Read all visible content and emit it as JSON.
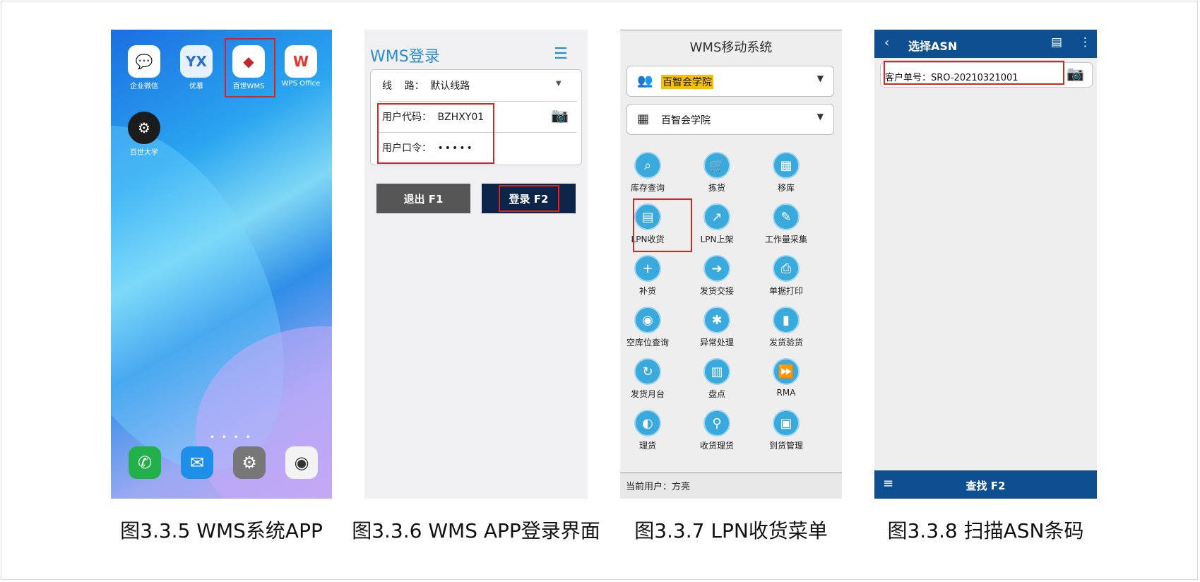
{
  "home": {
    "apps": [
      {
        "name": "企业微信",
        "icon": "wecom-icon"
      },
      {
        "name": "优慕",
        "icon": "youmu-icon"
      },
      {
        "name": "百世WMS",
        "icon": "wms-app-icon"
      },
      {
        "name": "WPS Office",
        "icon": "wps-icon"
      },
      {
        "name": "百世大学",
        "icon": "university-icon"
      }
    ],
    "dock": [
      "phone-icon",
      "message-icon",
      "settings-icon",
      "camera-icon"
    ],
    "icon_glyphs": {
      "wps": "W",
      "youmu": "YX"
    }
  },
  "login": {
    "title": "WMS登录",
    "line_label": "线    路：",
    "line_value": "默认线路",
    "user_label": "用户代码：",
    "user_value": "BZHXY01",
    "password_label": "用户口令：",
    "password_value": "•••••",
    "exit_button": "退出 F1",
    "login_button": "登录 F2",
    "colors": {
      "exit": "#565656",
      "login": "#0c2448",
      "accent": "#2a8fd2"
    }
  },
  "menu": {
    "title": "WMS移动系统",
    "org_select": "百智会学院",
    "warehouse_select": "百智会学院",
    "items": [
      {
        "label": "库存查询",
        "icon": "inventory-search-icon",
        "glyph": "⌕"
      },
      {
        "label": "拣货",
        "icon": "cart-icon",
        "glyph": "🛒"
      },
      {
        "label": "移库",
        "icon": "move-stock-icon",
        "glyph": "▦"
      },
      {
        "label": "LPN收货",
        "icon": "lpn-receive-icon",
        "glyph": "▤"
      },
      {
        "label": "LPN上架",
        "icon": "lpn-shelve-icon",
        "glyph": "↗"
      },
      {
        "label": "工作量采集",
        "icon": "workload-icon",
        "glyph": "✎"
      },
      {
        "label": "补货",
        "icon": "replenish-icon",
        "glyph": "+"
      },
      {
        "label": "发货交接",
        "icon": "handover-icon",
        "glyph": "➔"
      },
      {
        "label": "单据打印",
        "icon": "print-icon",
        "glyph": "⎙"
      },
      {
        "label": "空库位查询",
        "icon": "empty-location-icon",
        "glyph": "◉"
      },
      {
        "label": "异常处理",
        "icon": "exception-icon",
        "glyph": "✱"
      },
      {
        "label": "发货验货",
        "icon": "ship-check-icon",
        "glyph": "▮"
      },
      {
        "label": "发货月台",
        "icon": "dock-icon",
        "glyph": "↻"
      },
      {
        "label": "盘点",
        "icon": "stocktake-icon",
        "glyph": "▥"
      },
      {
        "label": "RMA",
        "icon": "rma-icon",
        "glyph": "⏩"
      },
      {
        "label": "理货",
        "icon": "tally-icon",
        "glyph": "◐"
      },
      {
        "label": "收货理货",
        "icon": "receive-tally-icon",
        "glyph": "⚲"
      },
      {
        "label": "到货管理",
        "icon": "arrival-icon",
        "glyph": "▣"
      }
    ],
    "current_user": "当前用户：方亮"
  },
  "asn": {
    "title": "选择ASN",
    "field": "客户单号：SRO-20210321001",
    "find_button": "查找 F2"
  },
  "captions": [
    "图3.3.5  WMS系统APP",
    "图3.3.6  WMS APP登录界面",
    "图3.3.7  LPN收货菜单",
    "图3.3.8  扫描ASN条码"
  ]
}
